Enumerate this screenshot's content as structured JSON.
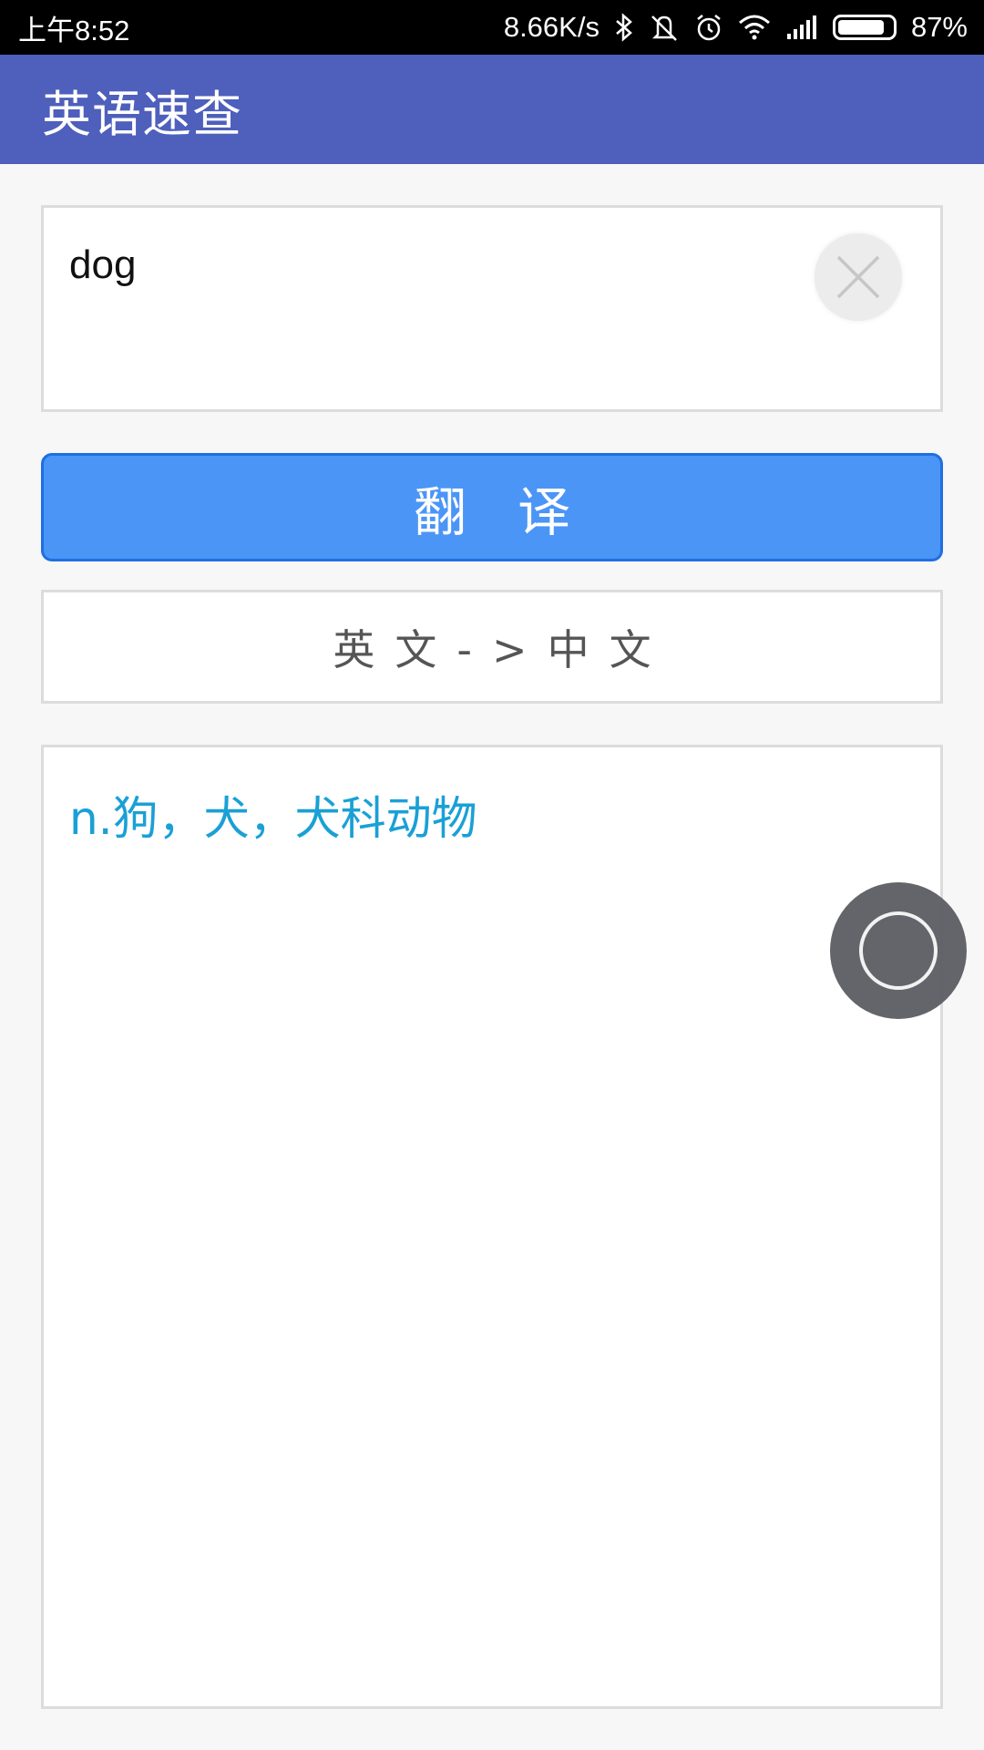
{
  "status_bar": {
    "time": "上午8:52",
    "net_speed": "8.66K/s",
    "battery": "87%",
    "battery_level": 0.87,
    "icons": [
      "bluetooth-icon",
      "mute-icon",
      "alarm-icon",
      "wifi-icon",
      "signal-icon",
      "battery-icon"
    ]
  },
  "app_bar": {
    "title": "英语速查"
  },
  "input": {
    "value": "dog",
    "clear_icon": "close-icon"
  },
  "translate_button": {
    "label": "翻译"
  },
  "direction": {
    "label": "英文->中文"
  },
  "result": {
    "text": "n.狗，犬，犬科动物"
  },
  "colors": {
    "app_bar": "#4e5fbc",
    "button": "#4b95f6",
    "result_text": "#1aa0d6"
  }
}
